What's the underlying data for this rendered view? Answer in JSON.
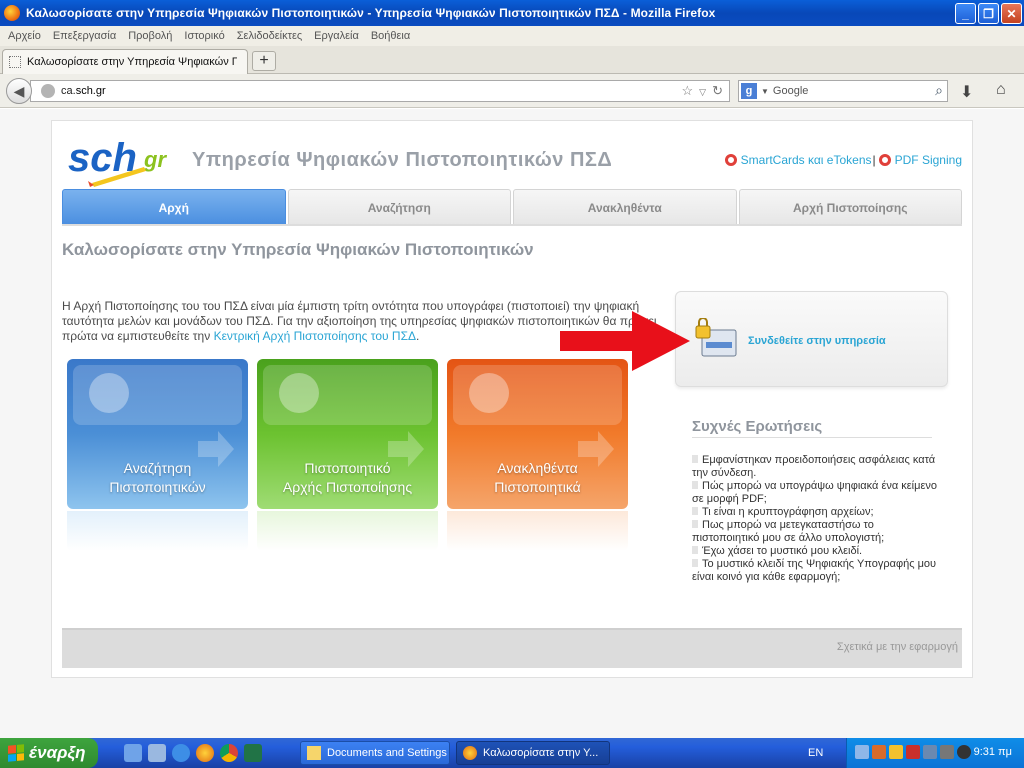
{
  "window": {
    "title": "Καλωσορίσατε στην Υπηρεσία Ψηφιακών Πιστοποιητικών - Υπηρεσία Ψηφιακών Πιστοποιητικών ΠΣΔ - Mozilla Firefox",
    "minimize": "_",
    "maximize": "❐",
    "close": "✕"
  },
  "menu": [
    "Αρχείο",
    "Επεξεργασία",
    "Προβολή",
    "Ιστορικό",
    "Σελιδοδείκτες",
    "Εργαλεία",
    "Βοήθεια"
  ],
  "browser_tab": {
    "title": "Καλωσορίσατε στην Υπηρεσία Ψηφιακών Πισ...",
    "new_tab": "+"
  },
  "navbar": {
    "url_prefix": "ca.",
    "url_domain": "sch.gr",
    "search_placeholder": "Google"
  },
  "site": {
    "title": "Υπηρεσία Ψηφιακών Πιστοποιητικών ΠΣΔ",
    "links": {
      "smartcards": "SmartCards και eTokens",
      "sep": "|",
      "pdf": "PDF Signing"
    },
    "tabs": [
      "Αρχή",
      "Αναζήτηση",
      "Ανακληθέντα",
      "Αρχή Πιστοποίησης"
    ],
    "welcome": "Καλωσορίσατε στην Υπηρεσία Ψηφιακών Πιστοποιητικών",
    "intro_text": "Η Αρχή Πιστοποίησης του του ΠΣΔ είναι μία έμπιστη τρίτη οντότητα που υπογράφει (πιστοποιεί) την ψηφιακή ταυτότητα μελών και μονάδων του ΠΣΔ. Για την αξιοποίηση της υπηρεσίας ψηφιακών πιστοποιητικών θα πρέπει πρώτα να εμπιστευθείτε την",
    "intro_link": "Κεντρική Αρχή Πιστοποίησης του ΠΣΔ",
    "intro_end": ".",
    "tiles": {
      "search": [
        "Αναζήτηση",
        "Πιστοποιητικών"
      ],
      "ca": [
        "Πιστοποιητικό",
        "Αρχής Πιστοποίησης"
      ],
      "revoked": [
        "Ανακληθέντα",
        "Πιστοποιητικά"
      ]
    },
    "login": "Συνδεθείτε στην υπηρεσία",
    "faq_title": "Συχνές Ερωτήσεις",
    "faq": [
      "Εμφανίστηκαν προειδοποιήσεις ασφάλειας κατά την σύνδεση.",
      "Πώς μπορώ να υπογράψω ψηφιακά ένα κείμενο σε μορφή PDF;",
      "Τι είναι η κρυπτογράφηση αρχείων;",
      "Πως μπορώ να μετεγκαταστήσω το πιστοποιητικό μου σε άλλο υπολογιστή;",
      "Έχω χάσει το μυστικό μου κλειδί.",
      "Το μυστικό κλειδί της Ψηφιακής Υπογραφής μου είναι κοινό για κάθε εφαρμογή;"
    ],
    "footer_about": "Σχετικά με την εφαρμογή"
  },
  "taskbar": {
    "start": "έναρξη",
    "task1": "Documents and Settings",
    "task2": "Καλωσορίσατε στην Υ...",
    "lang": "EN",
    "clock": "9:31 πμ"
  }
}
